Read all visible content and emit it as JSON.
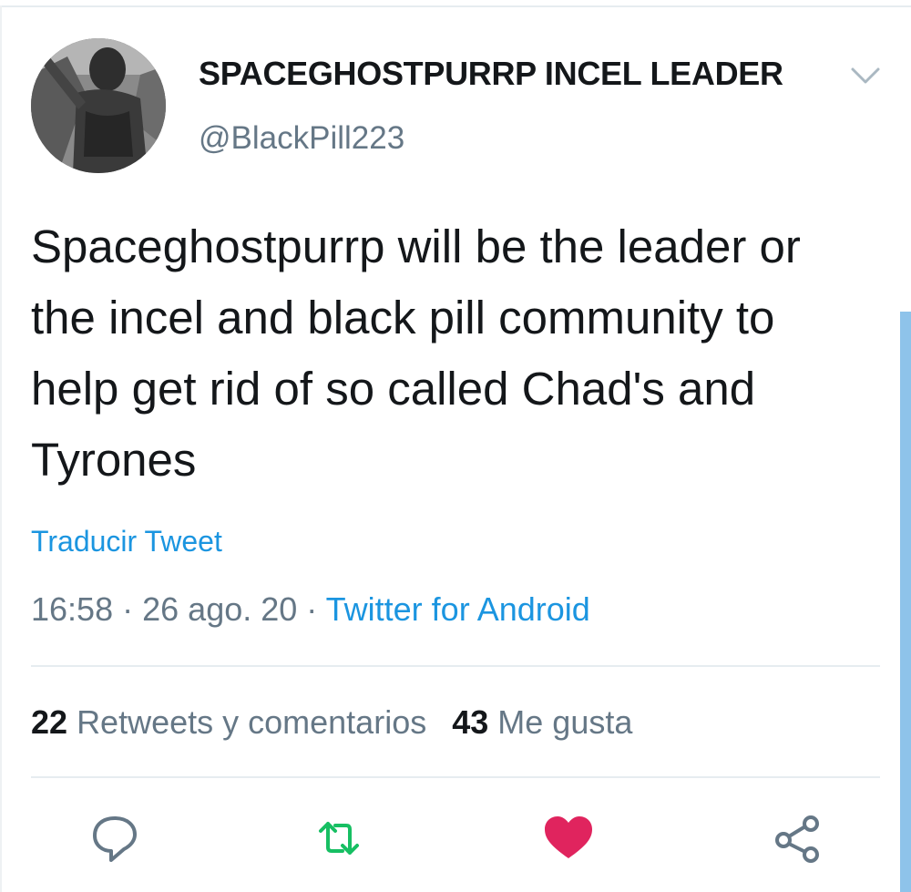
{
  "user": {
    "display_name": "SPACEGHOSTPURRP INCEL LEADER",
    "handle": "@BlackPill223"
  },
  "tweet": {
    "text": "Spaceghostpurrp will be the leader or the incel and black pill community to help get rid of so called Chad's and Tyrones",
    "translate_label": "Traducir Tweet",
    "time": "16:58",
    "separator": "·",
    "date": "26 ago. 20",
    "source": "Twitter for Android"
  },
  "stats": {
    "retweets_count": "22",
    "retweets_label": "Retweets y comentarios",
    "likes_count": "43",
    "likes_label": "Me gusta"
  },
  "actions": {
    "reply_icon": "reply-icon",
    "retweet_icon": "retweet-icon",
    "like_icon": "heart-icon",
    "share_icon": "share-icon"
  },
  "colors": {
    "accent": "#1b95e0",
    "retweet": "#17bf63",
    "like": "#e0245e",
    "text": "#14171a",
    "secondary": "#657786"
  }
}
